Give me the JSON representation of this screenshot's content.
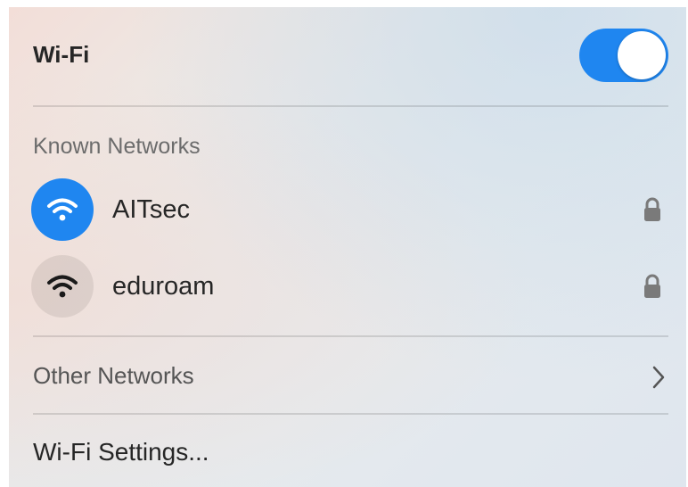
{
  "header": {
    "title": "Wi-Fi",
    "toggle_state": "on",
    "toggle_color": "#1f86f0"
  },
  "known_networks": {
    "label": "Known Networks",
    "items": [
      {
        "name": "AITsec",
        "icon": "wifi-icon",
        "connected": true,
        "secured": true,
        "lock_icon": "lock-icon"
      },
      {
        "name": "eduroam",
        "icon": "wifi-icon",
        "connected": false,
        "secured": true,
        "lock_icon": "lock-icon"
      }
    ]
  },
  "other_networks": {
    "label": "Other Networks",
    "icon": "chevron-right-icon"
  },
  "settings": {
    "label": "Wi-Fi Settings..."
  }
}
